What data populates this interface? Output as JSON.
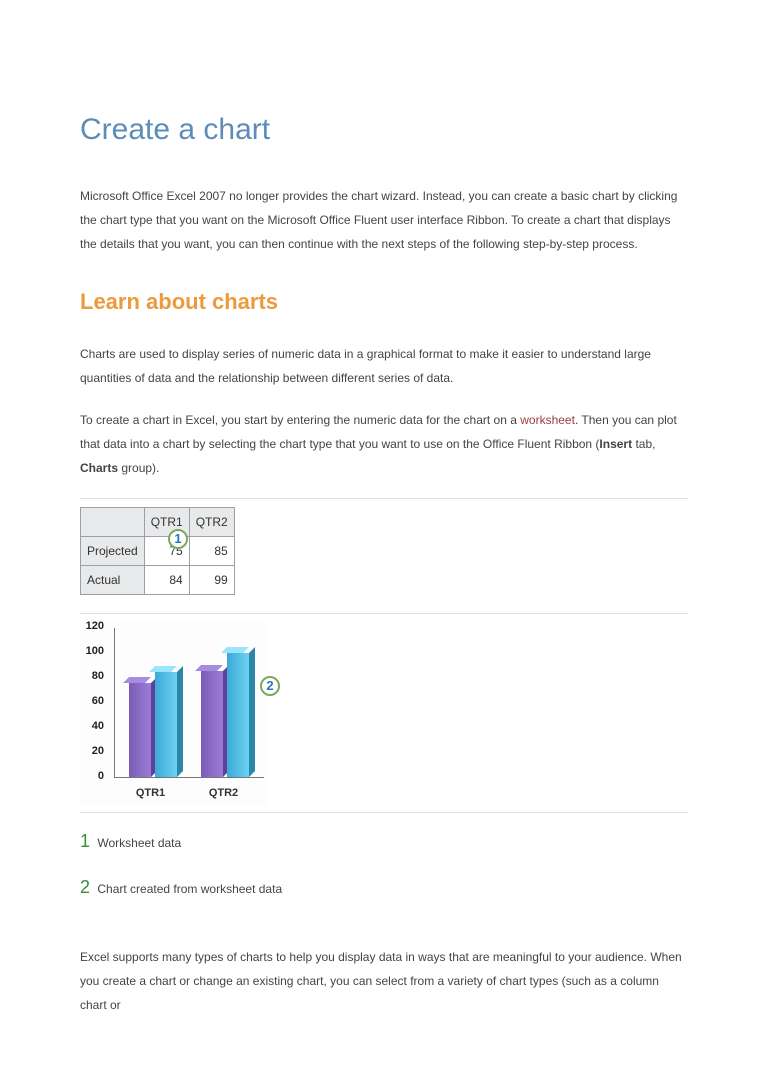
{
  "title": "Create a chart",
  "intro": "Microsoft Office Excel 2007 no longer provides the chart wizard. Instead, you can create a basic chart by clicking the chart type that you want on the Microsoft Office Fluent user interface Ribbon. To create a chart that displays the details that you want, you can then continue with the next steps of the following step-by-step process.",
  "section1_title": "Learn about charts",
  "section1_p1": "Charts are used to display series of numeric data in a graphical format to make it easier to understand large quantities of data and the relationship between different series of data.",
  "section1_p2a": "To create a chart in Excel, you start by entering the numeric data for the chart on a ",
  "section1_link": "worksheet",
  "section1_p2b": ". Then you can plot that data into a chart by selecting the chart type that you want to use on the Office Fluent Ribbon (",
  "section1_p2c": " tab, ",
  "section1_p2d": " group).",
  "bold_insert": "Insert",
  "bold_charts": "Charts",
  "worksheet": {
    "cols": [
      "QTR1",
      "QTR2"
    ],
    "rows": [
      {
        "label": "Projected",
        "vals": [
          "75",
          "85"
        ]
      },
      {
        "label": "Actual",
        "vals": [
          "84",
          "99"
        ]
      }
    ]
  },
  "callouts": {
    "c1": "1",
    "c2": "2"
  },
  "legend": {
    "l1_num": "1",
    "l1_text": "Worksheet data",
    "l2_num": "2",
    "l2_text": "Chart created from worksheet data"
  },
  "closing_p": "Excel supports many types of charts to help you display data in ways that are meaningful to your audience. When you create a chart or change an existing chart, you can select from a variety of chart types (such as a column chart or",
  "chart_data": {
    "type": "bar",
    "categories": [
      "QTR1",
      "QTR2"
    ],
    "series": [
      {
        "name": "Projected",
        "values": [
          75,
          85
        ]
      },
      {
        "name": "Actual",
        "values": [
          84,
          99
        ]
      }
    ],
    "ylim": [
      0,
      120
    ],
    "yticks": [
      0,
      20,
      40,
      60,
      80,
      100,
      120
    ],
    "xlabel": "",
    "ylabel": "",
    "title": ""
  }
}
